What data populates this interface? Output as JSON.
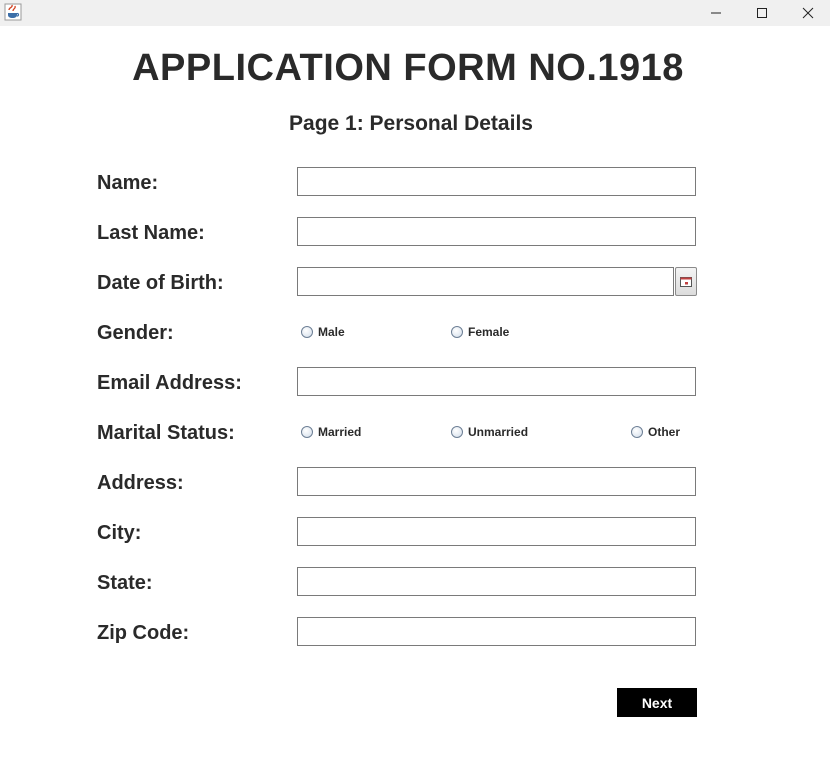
{
  "window": {
    "title": "",
    "app_icon": "java-cup-icon",
    "controls": {
      "minimize": "minimize-icon",
      "maximize": "maximize-icon",
      "close": "close-icon"
    }
  },
  "form": {
    "title": "APPLICATION FORM NO.1918",
    "subtitle": "Page 1: Personal Details",
    "fields": {
      "name": {
        "label": "Name:",
        "value": ""
      },
      "last_name": {
        "label": "Last Name:",
        "value": ""
      },
      "dob": {
        "label": "Date of Birth:",
        "value": "",
        "picker_icon": "calendar-icon"
      },
      "gender": {
        "label": "Gender:",
        "options": [
          "Male",
          "Female"
        ],
        "selected": null
      },
      "email": {
        "label": "Email Address:",
        "value": ""
      },
      "marital_status": {
        "label": "Marital Status:",
        "options": [
          "Married",
          "Unmarried",
          "Other"
        ],
        "selected": null
      },
      "address": {
        "label": "Address:",
        "value": ""
      },
      "city": {
        "label": "City:",
        "value": ""
      },
      "state": {
        "label": "State:",
        "value": ""
      },
      "zip": {
        "label": "Zip Code:",
        "value": ""
      }
    },
    "next_button": {
      "label": "Next",
      "background": "#000000",
      "color": "#ffffff"
    }
  }
}
